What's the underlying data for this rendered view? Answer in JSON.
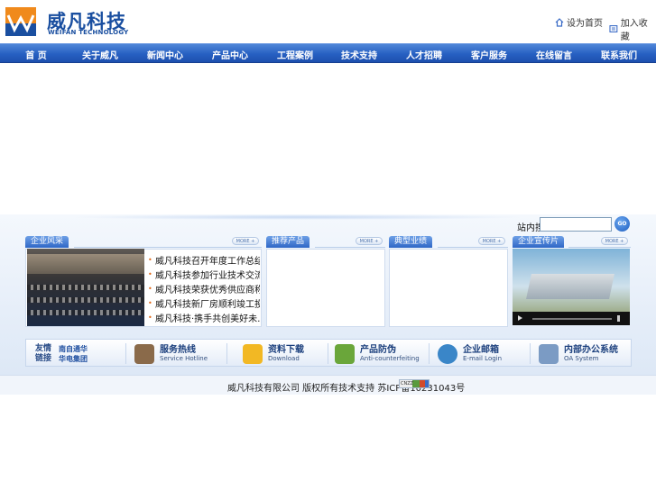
{
  "brand": {
    "name_cn": "威凡科技",
    "name_en": "WEIFAN TECHNOLOGY"
  },
  "top_links": {
    "home": "设为首页",
    "favorite": "加入收藏"
  },
  "nav": [
    "首 页",
    "关于威凡",
    "新闻中心",
    "产品中心",
    "工程案例",
    "技术支持",
    "人才招聘",
    "客户服务",
    "在线留言",
    "联系我们"
  ],
  "search": {
    "label": "站内搜索",
    "button": "GO",
    "value": ""
  },
  "panels": {
    "company": {
      "tab": "企业风采",
      "more": "MORE +"
    },
    "products": {
      "tab": "推荐产品",
      "more": "MORE +"
    },
    "cases": {
      "tab": "典型业绩",
      "more": "MORE +"
    },
    "video": {
      "tab": "企业宣传片",
      "more": "MORE +"
    }
  },
  "news": [
    "威凡科技召开年度工作总结…",
    "威凡科技参加行业技术交流…",
    "威凡科技荣获优秀供应商称…",
    "威凡科技新厂房顺利竣工投…",
    "威凡科技·携手共创美好未…"
  ],
  "services": [
    {
      "cn": "服务热线",
      "en": "Service Hotline",
      "icon": "phone-operator-icon",
      "color": "#8a6a4a"
    },
    {
      "cn": "资料下载",
      "en": "Download",
      "icon": "download-icon",
      "color": "#f2b824"
    },
    {
      "cn": "产品防伪",
      "en": "Anti-counterfeiting",
      "icon": "anti-fake-icon",
      "color": "#6aa63a"
    },
    {
      "cn": "企业邮箱",
      "en": "E-mail Login",
      "icon": "email-icon",
      "color": "#3a86c8"
    },
    {
      "cn": "内部办公系统",
      "en": "OA System",
      "icon": "computer-icon",
      "color": "#7b9bc4"
    }
  ],
  "friend_links": {
    "label_1": "友情",
    "label_2": "链接",
    "partner_1": "南自通华",
    "partner_2": "华电集团"
  },
  "footer": {
    "text": "威凡科技有限公司 版权所有技术支持 苏ICP备10231043号",
    "badge": "CNZZ"
  }
}
